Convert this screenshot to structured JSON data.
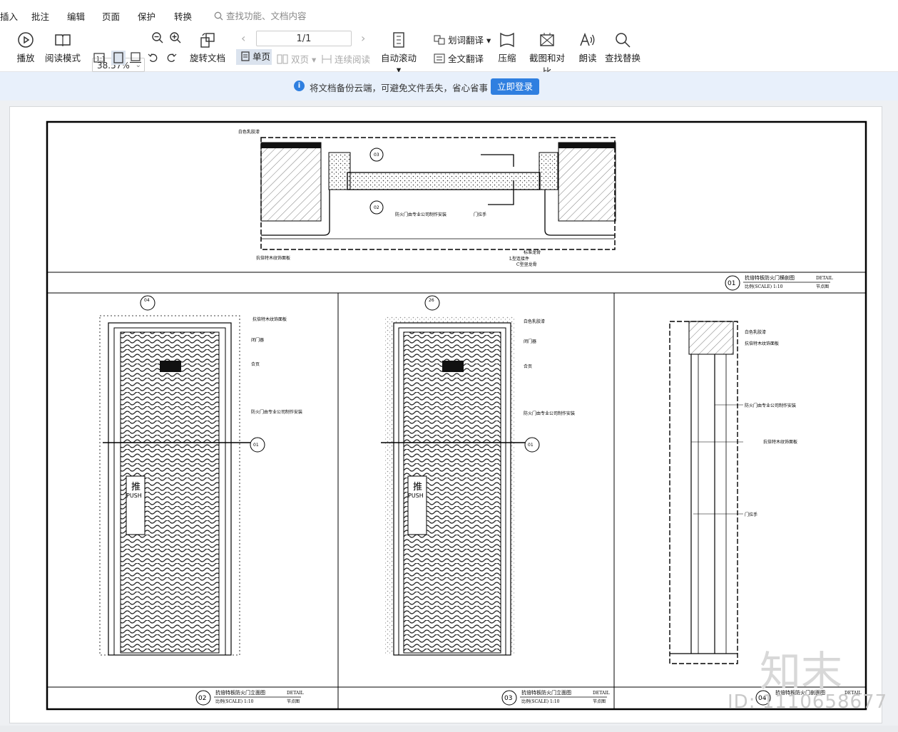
{
  "menu": {
    "insert": "插入",
    "annotate": "批注",
    "edit": "编辑",
    "page": "页面",
    "protect": "保护",
    "convert": "转换",
    "search_placeholder": "查找功能、文档内容"
  },
  "toolbar": {
    "play": "播放",
    "reading_mode": "阅读模式",
    "zoom": "38.57%",
    "rotate_doc": "旋转文档",
    "page_indicator": "1/1",
    "single_page": "单页",
    "double_page": "双页",
    "continuous": "连续阅读",
    "auto_scroll": "自动滚动",
    "word_translate": "划词翻译",
    "full_translate": "全文翻译",
    "compress": "压缩",
    "screenshot_compare": "截图和对比",
    "read_aloud": "朗读",
    "find_replace": "查找替换"
  },
  "notice": {
    "text": "将文档备份云端，可避免文件丢失，省心省事",
    "login_button": "立即登录"
  },
  "drawing": {
    "section_title": "抗倍特板防火门横剖图",
    "section_scale": "比例(SCALE) 1:10",
    "section_no": "01",
    "detail_en": "DETAIL",
    "detail_cn": "节点图",
    "elev_title_a": "抗倍特板防火门立面图",
    "elev_scale_a": "比例(SCALE) 1:10",
    "elev_no_a": "02",
    "elev_title_b": "抗倍特板防火门立面图",
    "elev_scale_b": "比例(SCALE) 1:10",
    "elev_no_b": "03",
    "side_title": "抗倍特板防火门剖面图",
    "side_no": "04",
    "push_cn": "推",
    "push_en": "PUSH",
    "labels": {
      "white_latex": "白色乳胶漆",
      "panel": "抗倍特木纹饰面板",
      "closer": "闭门器",
      "hinge": "合页",
      "fire_door": "防火门由专业公司制作安装",
      "handle": "门拉手",
      "mark_a": "04",
      "mark_b": "26",
      "mark_c": "01",
      "mark_d": "02",
      "mark_e": "03",
      "l_steel": "L型连接件",
      "c_steel": "C型竖龙骨",
      "std_steel": "标准龙骨"
    }
  },
  "watermark": {
    "logo": "知末",
    "id": "ID: 1110658677"
  }
}
